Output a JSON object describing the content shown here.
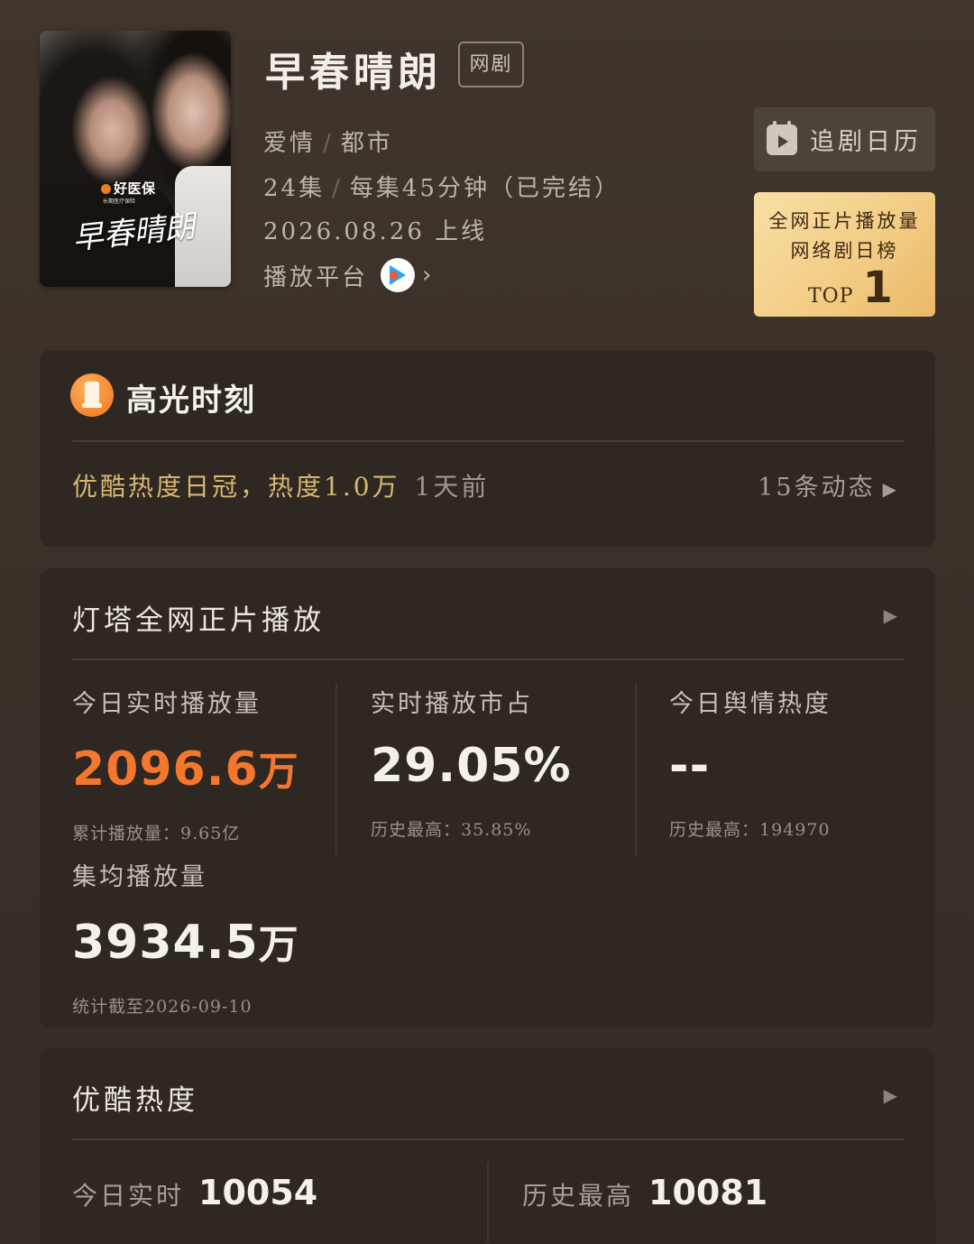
{
  "header": {
    "poster": {
      "brand_text": "好医保",
      "brand_subtext": "长期医疗保险",
      "title_art": "早春晴朗"
    },
    "title": "早春晴朗",
    "type_tag": "网剧",
    "genres": [
      "爱情",
      "都市"
    ],
    "episodes": "24集",
    "duration": "每集45分钟（已完结）",
    "release": "2026.08.26 上线",
    "platform_label": "播放平台",
    "platform_icon": "youku-logo-icon",
    "calendar_button": "追剧日历",
    "rank_card": {
      "line1": "全网正片播放量",
      "line2": "网络剧日榜",
      "top_label": "TOP",
      "top_number": "1"
    }
  },
  "highlight": {
    "title": "高光时刻",
    "text": "优酷热度日冠，热度1.0万",
    "time": "1天前",
    "more": "15条动态"
  },
  "beacon": {
    "title": "灯塔全网正片播放",
    "metrics": [
      {
        "label": "今日实时播放量",
        "value": "2096.6",
        "unit": "万",
        "sub": "累计播放量：9.65亿"
      },
      {
        "label": "实时播放市占",
        "value": "29.05%",
        "unit": "",
        "sub": "历史最高：35.85%"
      },
      {
        "label": "今日舆情热度",
        "value": "--",
        "unit": "",
        "sub": "历史最高：194970"
      }
    ],
    "avg": {
      "label": "集均播放量",
      "value": "3934.5",
      "unit": "万",
      "sub": "统计截至2026-09-10"
    }
  },
  "youku": {
    "title": "优酷热度",
    "today_label": "今日实时",
    "today_value": "10054",
    "peak_label": "历史最高",
    "peak_value": "10081"
  },
  "colors": {
    "accent_orange": "#f3782e",
    "gold_text": "#d8b772",
    "rank_card_bg": "#f3cd86"
  }
}
